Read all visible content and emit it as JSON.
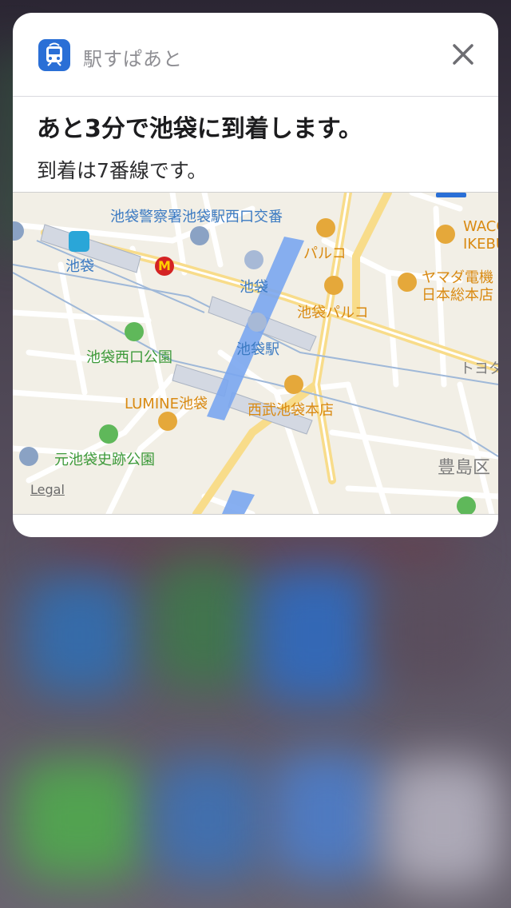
{
  "notification": {
    "app_name": "駅すぱあと",
    "title": "あと3分で池袋に到着します。",
    "body": "到着は7番線です。",
    "close_label": "×"
  },
  "map": {
    "labels": {
      "police_box": "池袋警察署池袋駅西口交番",
      "metro_ikebukuro": "池袋",
      "parco": "パルコ",
      "wacoal_line1": "WACO",
      "wacoal_line2": "IKEBU",
      "yamada_line1": "ヤマダ電機",
      "yamada_line2": "日本総本店",
      "jr_ikebukuro": "池袋",
      "ikebukuro_parco": "池袋パルコ",
      "ikebukuro_station": "池袋駅",
      "nishiguchi_park": "池袋西口公園",
      "toyota": "トヨタ",
      "lumine": "LUMINE池袋",
      "seibu": "西武池袋本店",
      "motoikebukuro_park": "元池袋史跡公園",
      "toshima_ward": "豊島区",
      "legal": "Legal"
    }
  },
  "colors": {
    "app_icon": "#2a6fd6",
    "park_green": "#3d9a3a",
    "shop_orange": "#d98a12",
    "transit_blue": "#3b7ac2"
  }
}
